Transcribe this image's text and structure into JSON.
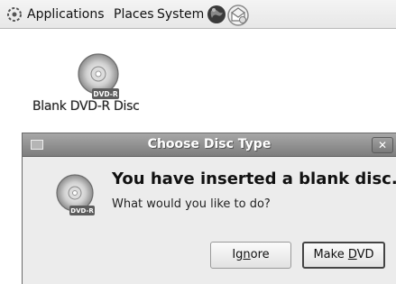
{
  "panel": {
    "menus": [
      "Applications",
      "Places",
      "System"
    ],
    "icons": [
      "gnome-foot-icon",
      "web-browser-globe-icon",
      "mail-client-icon"
    ]
  },
  "desktop": {
    "icon_label": "Blank DVD-R Disc",
    "icon_badge": "DVD-R"
  },
  "dialog": {
    "title": "Choose Disc Type",
    "heading": "You have inserted a blank disc.",
    "message": "What would you like to do?",
    "icon_badge": "DVD-R",
    "buttons": {
      "ignore": {
        "label": "Ignore",
        "mnemonic_prefix": "Ig",
        "mnemonic": "n",
        "rest": "ore"
      },
      "make": {
        "label": "Make DVD",
        "mnemonic_prefix": "Make ",
        "mnemonic": "D",
        "rest": "VD"
      }
    }
  },
  "colors": {
    "titlebar": "#8f8f8f",
    "dialog_bg": "#ececec",
    "panel_bg": "#ececec"
  }
}
